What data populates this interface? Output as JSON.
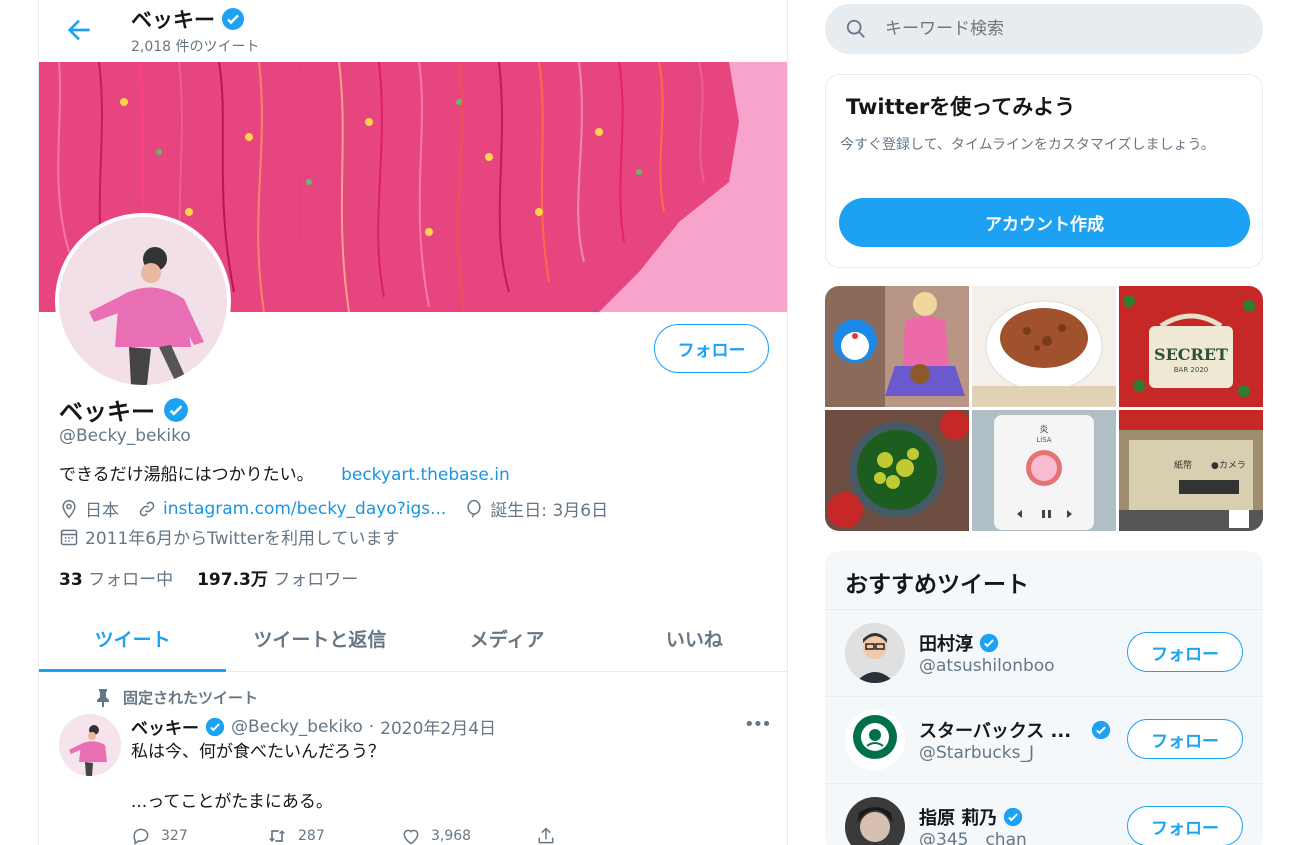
{
  "header": {
    "name": "ベッキー",
    "tweet_count": "2,018 件のツイート"
  },
  "profile": {
    "name": "ベッキー",
    "handle": "@Becky_bekiko",
    "bio": "できるだけ湯船にはつかりたい。",
    "bio_link": "beckyart.thebase.in",
    "location": "日本",
    "website": "instagram.com/becky_dayo?igs...",
    "birthday": "誕生日: 3月6日",
    "joined": "2011年6月からTwitterを利用しています",
    "following_count": "33",
    "following_label": "フォロー中",
    "followers_count": "197.3万",
    "followers_label": "フォロワー",
    "follow_label": "フォロー"
  },
  "tabs": [
    "ツイート",
    "ツイートと返信",
    "メディア",
    "いいね"
  ],
  "pinned_tweet": {
    "pinned_label": "固定されたツイート",
    "name": "ベッキー",
    "handle": "@Becky_bekiko",
    "separator": "·",
    "date": "2020年2月4日",
    "text": "私は今、何が食べたいんだろう？\n\n...ってことがたまにある。",
    "replies": "327",
    "retweets": "287",
    "likes": "3,968",
    "more": "•••"
  },
  "search": {
    "placeholder": "キーワード検索"
  },
  "signup": {
    "title": "Twitterを使ってみよう",
    "text": "今すぐ登録して、タイムラインをカスタマイズしましょう。",
    "button": "アカウント作成"
  },
  "media_text": {
    "bag": "SECRET",
    "bag_sub": "BAR 2020",
    "player_title": "炎",
    "player_artist": "LiSA",
    "sign_text": "紙幣",
    "sign_camera": "●カメラ"
  },
  "recommended": {
    "title": "おすすめツイート",
    "follow_label": "フォロー",
    "accounts": [
      {
        "name": "田村淳",
        "handle": "@atsushilonboo"
      },
      {
        "name": "スターバックス ...",
        "handle": "@Starbucks_J"
      },
      {
        "name": "指原 莉乃",
        "handle": "@345__chan"
      }
    ]
  },
  "colors": {
    "accent": "#1da1f2",
    "secondary_text": "#657786",
    "border": "#e6ecf0",
    "banner_pink": "#f59bc4"
  },
  "icons": [
    "back-arrow-icon",
    "verified-icon",
    "location-icon",
    "link-icon",
    "birthday-icon",
    "calendar-icon",
    "pin-icon",
    "reply-icon",
    "retweet-icon",
    "like-icon",
    "share-icon",
    "search-icon",
    "more-icon"
  ]
}
